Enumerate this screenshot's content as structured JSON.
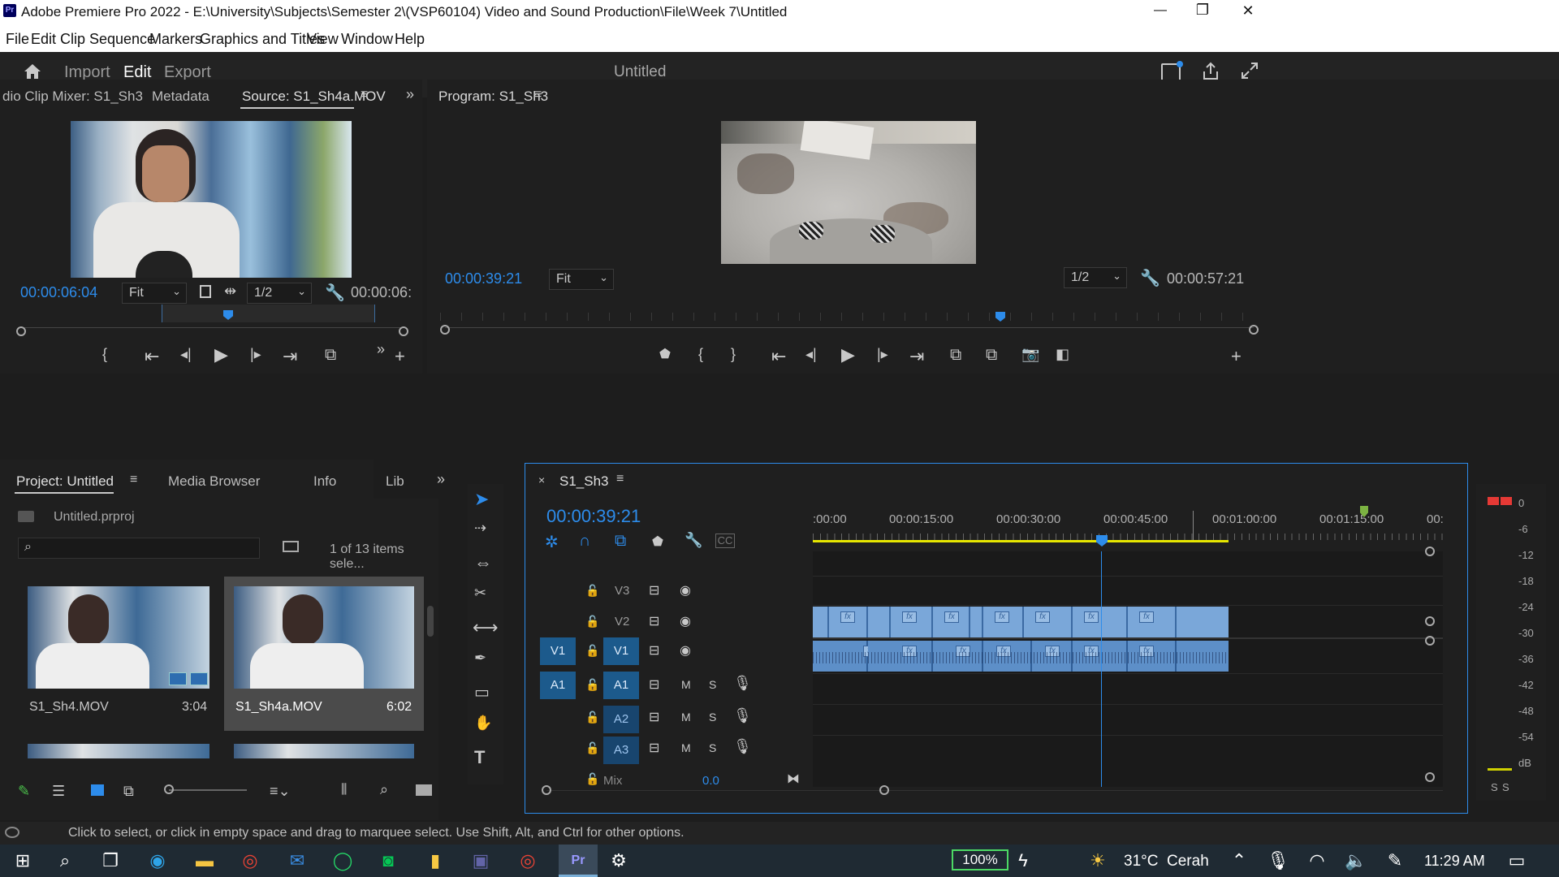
{
  "window": {
    "app_icon": "Pr",
    "title": "Adobe Premiere Pro 2022 - E:\\University\\Subjects\\Semester 2\\(VSP60104) Video and Sound Production\\File\\Week 7\\Untitled",
    "controls": {
      "minimize": "—",
      "maximize": "❐",
      "close": "✕"
    }
  },
  "menu": [
    "File",
    "Edit",
    "Clip",
    "Sequence",
    "Markers",
    "Graphics and Titles",
    "View",
    "Window",
    "Help"
  ],
  "workspace": {
    "tabs": [
      {
        "label": "Import",
        "active": false
      },
      {
        "label": "Edit",
        "active": true
      },
      {
        "label": "Export",
        "active": false
      }
    ],
    "project_title": "Untitled"
  },
  "source_panel": {
    "tabs": [
      "dio Clip Mixer: S1_Sh3",
      "Metadata",
      "Source: S1_Sh4a.MOV"
    ],
    "timecode": "00:00:06:04",
    "fit": "Fit",
    "resolution": "1/2",
    "duration": "00:00:06:"
  },
  "program_panel": {
    "tab": "Program: S1_Sh3",
    "timecode": "00:00:39:21",
    "fit": "Fit",
    "resolution": "1/2",
    "duration": "00:00:57:21"
  },
  "project_panel": {
    "tabs": [
      "Project: Untitled",
      "Media Browser",
      "Info",
      "Lib"
    ],
    "file": "Untitled.prproj",
    "items_status": "1 of 13 items sele...",
    "clips": [
      {
        "name": "S1_Sh4.MOV",
        "duration": "3:04",
        "selected": false
      },
      {
        "name": "S1_Sh4a.MOV",
        "duration": "6:02",
        "selected": true
      }
    ]
  },
  "timeline": {
    "sequence": "S1_Sh3",
    "timecode": "00:00:39:21",
    "ruler": [
      ":00:00",
      "00:00:15:00",
      "00:00:30:00",
      "00:00:45:00",
      "00:01:00:00",
      "00:01:15:00",
      "00:"
    ],
    "video_tracks": [
      {
        "src": "",
        "name": "V3"
      },
      {
        "src": "",
        "name": "V2"
      },
      {
        "src": "V1",
        "name": "V1"
      }
    ],
    "audio_tracks": [
      {
        "src": "A1",
        "name": "A1",
        "m": "M",
        "s": "S"
      },
      {
        "src": "",
        "name": "A2",
        "m": "M",
        "s": "S"
      },
      {
        "src": "",
        "name": "A3",
        "m": "M",
        "s": "S"
      }
    ],
    "mix_label": "Mix",
    "mix_value": "0.0",
    "fx_label": "fx"
  },
  "meters": {
    "scale": [
      "0",
      "-6",
      "-12",
      "-18",
      "-24",
      "-30",
      "-36",
      "-42",
      "-48",
      "-54",
      "dB"
    ],
    "solo": [
      "S",
      "S"
    ]
  },
  "status": "Click to select, or click in empty space and drag to marquee select. Use Shift, Alt, and Ctrl for other options.",
  "taskbar": {
    "battery": "100%",
    "weather": "31°C  Cerah",
    "time": "11:29 AM"
  },
  "colors": {
    "accent": "#2d8ceb",
    "clip_video": "#7aa7d9",
    "clip_audio": "#5d8fc8",
    "playhead": "#2d8ceb",
    "work_area": "#e6e600"
  }
}
